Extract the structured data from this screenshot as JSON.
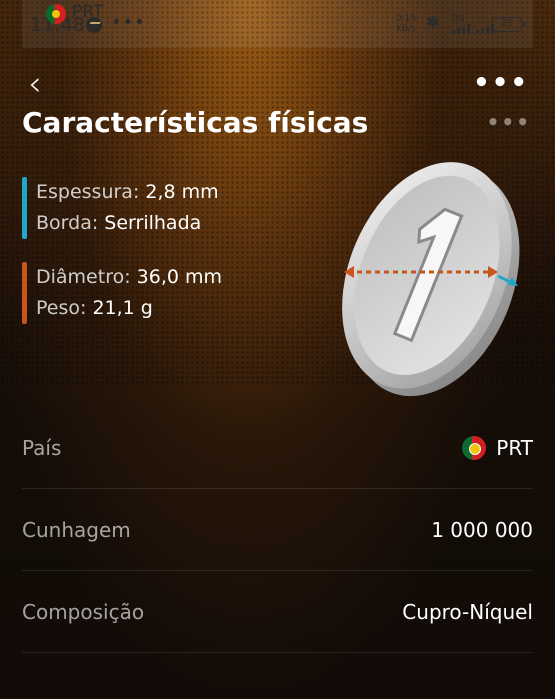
{
  "status_bar": {
    "time": "11:48",
    "notification_country": "PRT",
    "net_speed_value": "0.15",
    "net_speed_unit": "KB/s",
    "network_type": "5G",
    "battery": "21",
    "icons": [
      "portugal-flag-icon",
      "messenger-icon",
      "bluetooth-icon",
      "signal-icon",
      "battery-icon"
    ]
  },
  "header": {
    "back_icon": "‹",
    "more_icon": "•••",
    "title": "Características físicas",
    "title_more_icon": "•••"
  },
  "specs": {
    "group1_color": "#1ea7c9",
    "group2_color": "#c8561c",
    "thickness_label": "Espessura:",
    "thickness_value": "2,8 mm",
    "edge_label": "Borda:",
    "edge_value": "Serrilhada",
    "diameter_label": "Diâmetro:",
    "diameter_value": "36,0 mm",
    "weight_label": "Peso:",
    "weight_value": "21,1 g"
  },
  "coin": {
    "numeral": "1",
    "diameter_arrow_color": "#c8561c",
    "thickness_arrow_color": "#1ea7c9"
  },
  "details": [
    {
      "label": "País",
      "value": "PRT",
      "icon": "portugal-flag-icon"
    },
    {
      "label": "Cunhagem",
      "value": "1 000 000"
    },
    {
      "label": "Composição",
      "value": "Cupro-Níquel"
    }
  ]
}
